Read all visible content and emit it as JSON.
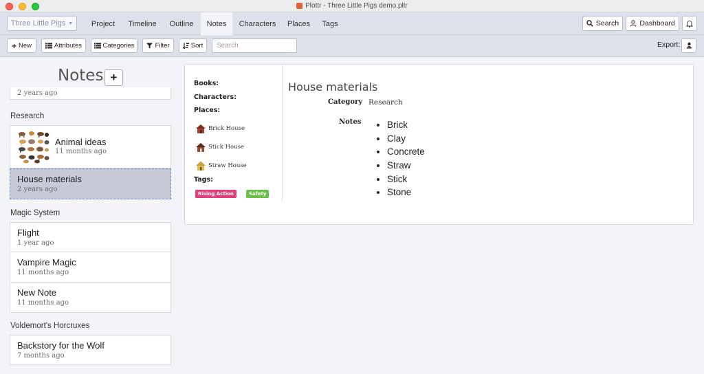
{
  "window": {
    "title": "Plottr - Three Little Pigs demo.pltr"
  },
  "navbar": {
    "project": "Three Little Pigs",
    "tabs": [
      "Project",
      "Timeline",
      "Outline",
      "Notes",
      "Characters",
      "Places",
      "Tags"
    ],
    "active_tab": "Notes",
    "search_label": "Search",
    "dashboard_label": "Dashboard"
  },
  "toolbar": {
    "new_label": "New",
    "attributes_label": "Attributes",
    "categories_label": "Categories",
    "filter_label": "Filter",
    "sort_label": "Sort",
    "search_placeholder": "Search",
    "export_label": "Export:"
  },
  "sidebar": {
    "heading": "Notes",
    "top_card_meta": "2 years ago",
    "sections": [
      {
        "name": "Research",
        "notes": [
          {
            "title": "Animal ideas",
            "meta": "11 months ago"
          },
          {
            "title": "House materials",
            "meta": "2 years ago"
          }
        ]
      },
      {
        "name": "Magic System",
        "notes": [
          {
            "title": "Flight",
            "meta": "1 year ago"
          },
          {
            "title": "Vampire Magic",
            "meta": "11 months ago"
          },
          {
            "title": "New Note",
            "meta": "11 months ago"
          }
        ]
      },
      {
        "name": "Voldemort's Horcruxes",
        "notes": [
          {
            "title": "Backstory for the Wolf",
            "meta": "7 months ago"
          }
        ]
      }
    ]
  },
  "note": {
    "books_label": "Books:",
    "characters_label": "Characters:",
    "places_label": "Places:",
    "places": [
      "Brick House",
      "Stick House",
      "Straw House"
    ],
    "tags_label": "Tags:",
    "tags": [
      {
        "name": "Rising Action",
        "color": "#e0407a"
      },
      {
        "name": "Safety",
        "color": "#6cc04a"
      }
    ],
    "title": "House materials",
    "category_label": "Category",
    "category_value": "Research",
    "notes_label": "Notes",
    "items": [
      "Brick",
      "Clay",
      "Concrete",
      "Straw",
      "Stick",
      "Stone"
    ]
  },
  "colors": {
    "accent_selected": "#c5cad6",
    "selection_border": "#5a8ec6",
    "navbar_bg": "#dde2ea"
  }
}
